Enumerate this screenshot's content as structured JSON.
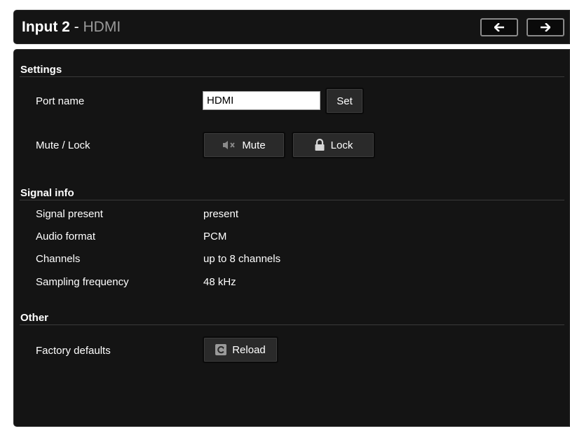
{
  "header": {
    "title_main": "Input 2",
    "title_sep": " - ",
    "title_sub": "HDMI",
    "prev_icon": "arrow-left-icon",
    "next_icon": "arrow-right-icon"
  },
  "settings": {
    "title": "Settings",
    "port_name_label": "Port name",
    "port_name_value": "HDMI",
    "set_label": "Set",
    "mute_lock_label": "Mute / Lock",
    "mute_label": "Mute",
    "mute_icon": "speaker-mute-icon",
    "lock_label": "Lock",
    "lock_icon": "padlock-icon"
  },
  "signal_info": {
    "title": "Signal info",
    "rows": [
      {
        "label": "Signal present",
        "value": "present"
      },
      {
        "label": "Audio format",
        "value": "PCM"
      },
      {
        "label": "Channels",
        "value": "up to 8 channels"
      },
      {
        "label": "Sampling frequency",
        "value": "48 kHz"
      }
    ]
  },
  "other": {
    "title": "Other",
    "factory_defaults_label": "Factory defaults",
    "reload_label": "Reload",
    "reload_icon": "reload-icon"
  },
  "colors": {
    "panel_bg": "#141414",
    "button_bg": "#2a2a2a",
    "muted_text": "#9a9a9a"
  }
}
